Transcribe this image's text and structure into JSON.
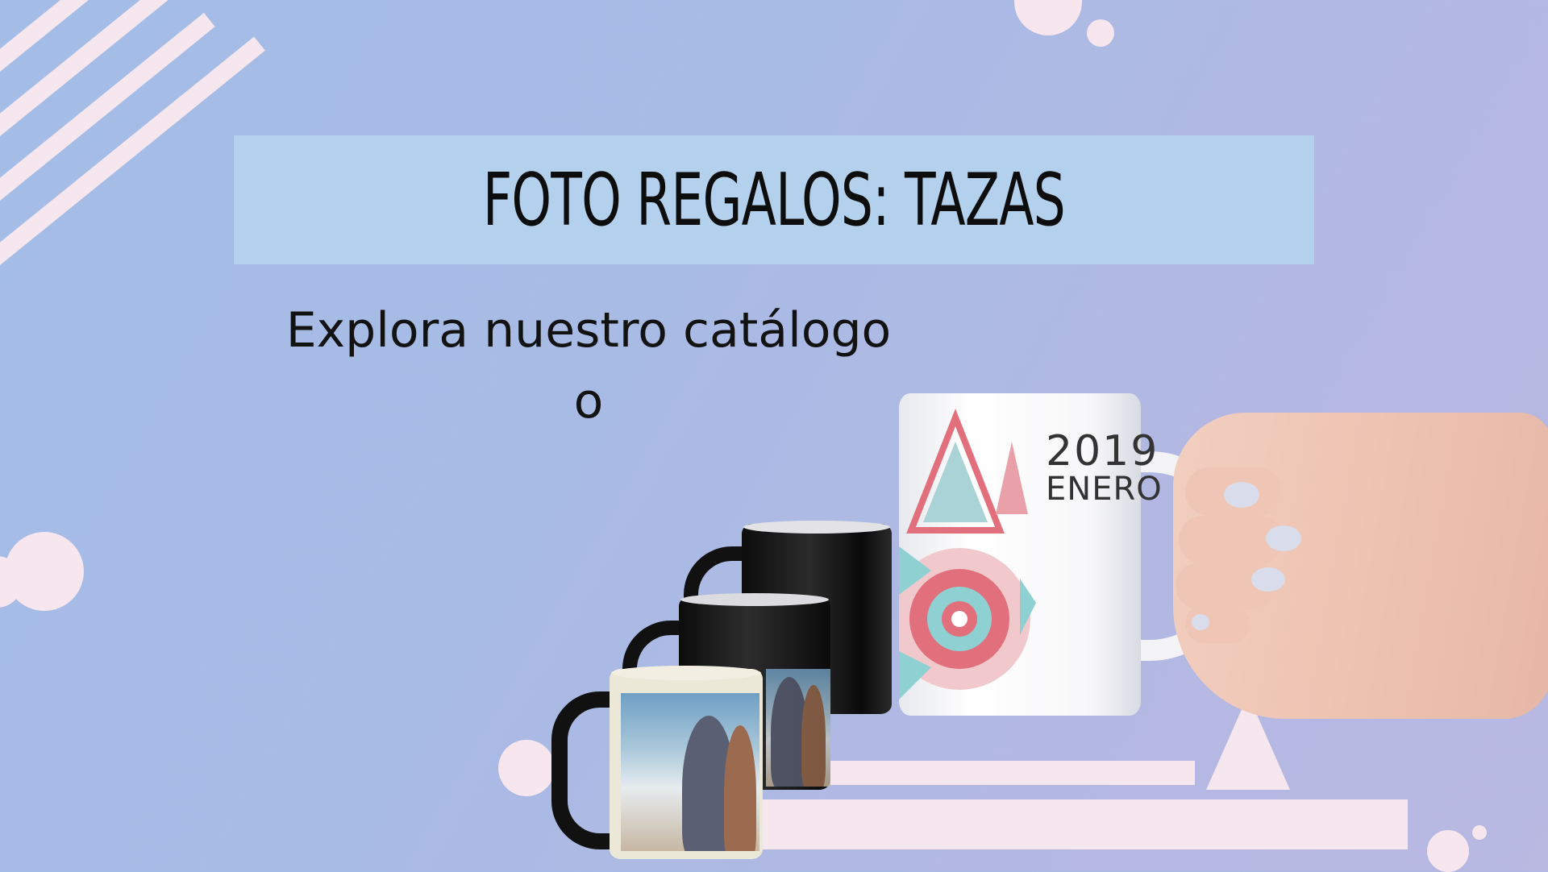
{
  "slide": {
    "title": "FOTO REGALOS: TAZAS",
    "subtitle_line1": "Explora nuestro catálogo",
    "subtitle_line2": "o"
  },
  "mug_print": {
    "year": "2019",
    "month": "ENERO"
  },
  "colors": {
    "background": "#a8bbe5",
    "title_band": "#b3d0ec",
    "decor": "#f6e6ee",
    "title_text": "#0d0d0d"
  }
}
